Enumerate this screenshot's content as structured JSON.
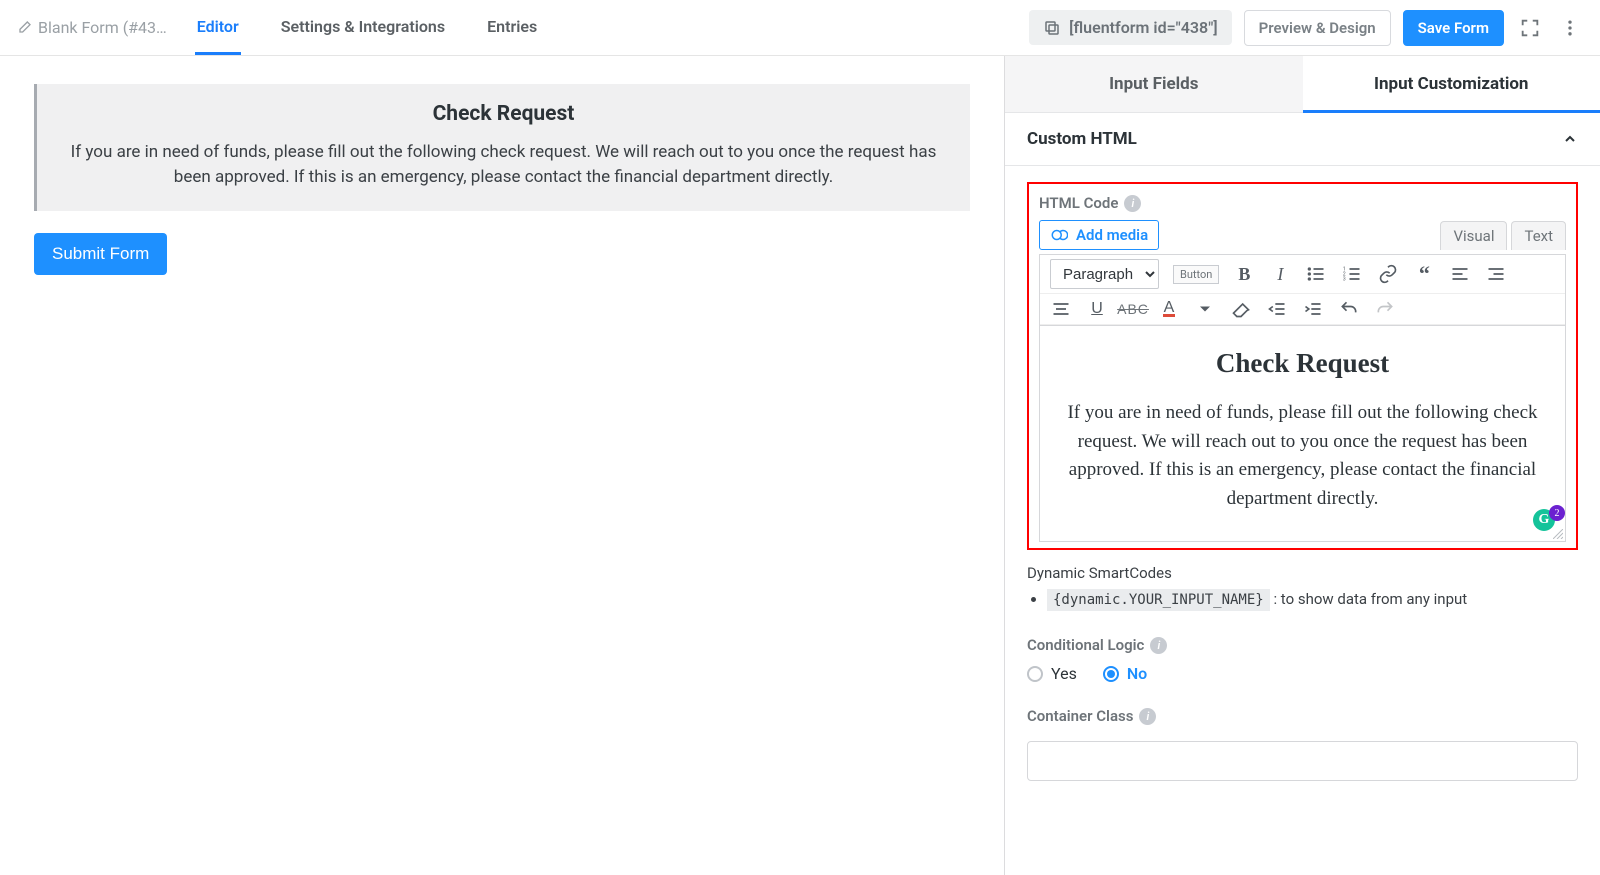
{
  "topbar": {
    "form_title": "Blank Form (#43…",
    "tabs": {
      "editor": "Editor",
      "settings": "Settings & Integrations",
      "entries": "Entries"
    },
    "shortcode": "[fluentform id=\"438\"]",
    "preview": "Preview & Design",
    "save": "Save Form"
  },
  "canvas": {
    "heading": "Check Request",
    "body": "If you are in need of funds, please fill out the following check request. We will reach out to you once the request has been approved. If this is an emergency, please contact the financial department directly.",
    "submit": "Submit Form"
  },
  "side": {
    "tabs": {
      "fields": "Input Fields",
      "custom": "Input Customization"
    },
    "section_title": "Custom HTML",
    "html_code_label": "HTML Code",
    "add_media": "Add media",
    "editor_tabs": {
      "visual": "Visual",
      "text": "Text"
    },
    "paragraph_dropdown": "Paragraph",
    "button_chip": "Button",
    "wysiwyg": {
      "heading": "Check Request",
      "body": "If you are in need of funds, please fill out the following check request. We will reach out to you once the request has been approved. If this is an emergency, please contact the financial department directly."
    },
    "grammarly_badge": "2",
    "smartcodes_label": "Dynamic SmartCodes",
    "smartcode_value": "{dynamic.YOUR_INPUT_NAME}",
    "smartcode_desc": ": to show data from any input",
    "cond_label": "Conditional Logic",
    "cond_yes": "Yes",
    "cond_no": "No",
    "cclass_label": "Container Class"
  }
}
